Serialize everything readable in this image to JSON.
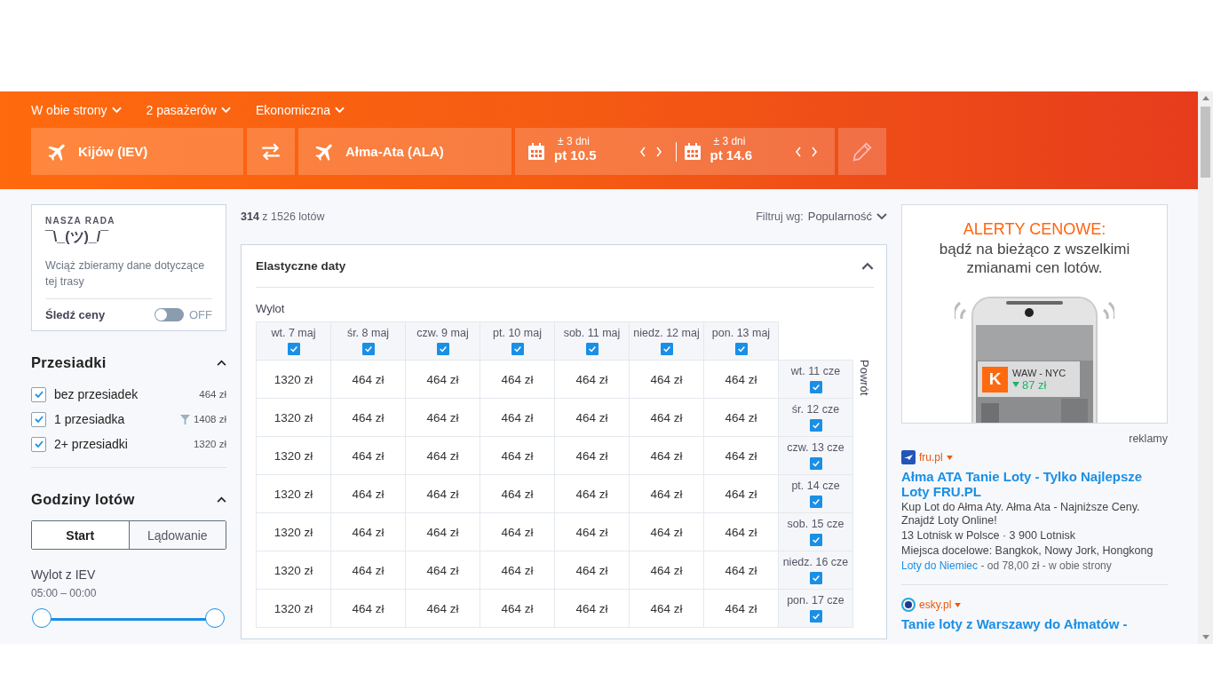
{
  "search_bar": {
    "trip_type": "W obie strony",
    "passengers": "2 pasażerów",
    "cabin": "Ekonomiczna",
    "origin": "Kijów (IEV)",
    "destination": "Ałma-Ata (ALA)",
    "dates": [
      {
        "flex": "± 3 dni",
        "date": "pt 10.5"
      },
      {
        "flex": "± 3 dni",
        "date": "pt 14.6"
      }
    ]
  },
  "advice": {
    "heading": "NASZA RADA",
    "emoticon": "¯\\_(ツ)_/¯",
    "text": "Wciąż zbieramy dane dotyczące tej trasy",
    "track_label": "Śledź ceny",
    "track_on": false,
    "track_state": "OFF"
  },
  "stops": {
    "title": "Przesiadki",
    "items": [
      {
        "label": "bez przesiadek",
        "price": "464 zł",
        "checked": true,
        "filtered": false
      },
      {
        "label": "1 przesiadka",
        "price": "1408 zł",
        "checked": true,
        "filtered": true
      },
      {
        "label": "2+ przesiadki",
        "price": "1320 zł",
        "checked": true,
        "filtered": false
      }
    ]
  },
  "times": {
    "title": "Godziny lotów",
    "tabs": [
      {
        "label": "Start",
        "selected": true
      },
      {
        "label": "Lądowanie",
        "selected": false
      }
    ],
    "label": "Wylot z IEV",
    "range": "05:00 – 00:00",
    "level": 1
  },
  "results": {
    "count": "314",
    "total": "z 1526 lotów",
    "sort_label": "Filtruj wg:",
    "sort_value": "Popularność"
  },
  "flex_dates": {
    "title": "Elastyczne daty",
    "departure_label": "Wylot",
    "return_label": "Powrót",
    "columns": [
      {
        "label": "wt. 7 maj",
        "checked": true
      },
      {
        "label": "śr. 8 maj",
        "checked": true
      },
      {
        "label": "czw. 9 maj",
        "checked": true
      },
      {
        "label": "pt. 10 maj",
        "checked": true
      },
      {
        "label": "sob. 11 maj",
        "checked": true
      },
      {
        "label": "niedz. 12 maj",
        "checked": true
      },
      {
        "label": "pon. 13 maj",
        "checked": true
      }
    ],
    "rows": [
      {
        "label": "wt. 11 cze",
        "checked": true,
        "prices": [
          "1320 zł",
          "464 zł",
          "464 zł",
          "464 zł",
          "464 zł",
          "464 zł",
          "464 zł"
        ]
      },
      {
        "label": "śr. 12 cze",
        "checked": true,
        "prices": [
          "1320 zł",
          "464 zł",
          "464 zł",
          "464 zł",
          "464 zł",
          "464 zł",
          "464 zł"
        ]
      },
      {
        "label": "czw. 13 cze",
        "checked": true,
        "prices": [
          "1320 zł",
          "464 zł",
          "464 zł",
          "464 zł",
          "464 zł",
          "464 zł",
          "464 zł"
        ]
      },
      {
        "label": "pt. 14 cze",
        "checked": true,
        "prices": [
          "1320 zł",
          "464 zł",
          "464 zł",
          "464 zł",
          "464 zł",
          "464 zł",
          "464 zł"
        ]
      },
      {
        "label": "sob. 15 cze",
        "checked": true,
        "prices": [
          "1320 zł",
          "464 zł",
          "464 zł",
          "464 zł",
          "464 zł",
          "464 zł",
          "464 zł"
        ]
      },
      {
        "label": "niedz. 16 cze",
        "checked": true,
        "prices": [
          "1320 zł",
          "464 zł",
          "464 zł",
          "464 zł",
          "464 zł",
          "464 zł",
          "464 zł"
        ]
      },
      {
        "label": "pon. 17 cze",
        "checked": true,
        "prices": [
          "1320 zł",
          "464 zł",
          "464 zł",
          "464 zł",
          "464 zł",
          "464 zł",
          "464 zł"
        ]
      }
    ]
  },
  "banner": {
    "headline": "ALERTY CENOWE:",
    "text": "bądź na bieżąco z wszelkimi zmianami cen lotów.",
    "notification_logo": "K",
    "notification_route": "WAW - NYC",
    "notification_price": "87 zł"
  },
  "ads": {
    "label": "reklamy",
    "items": [
      {
        "kind": "fru",
        "source": "fru.pl",
        "title": "Ałma ATA Tanie Loty - Tylko Najlepsze Loty FRU.PL",
        "lines": [
          "Kup Lot do Ałma Aty. Ałma Ata - Najniższe Ceny. Znajdź Loty Online!",
          "13 Lotnisk w Polsce · 3 900 Lotnisk",
          "Miejsca docelowe: Bangkok, Nowy Jork, Hongkong"
        ],
        "link": "Loty do Niemiec",
        "link_rest": "- od 78,00 zł - w obie strony"
      },
      {
        "kind": "esky",
        "source": "esky.pl",
        "title": "Tanie loty z Warszawy do Ałmatów -"
      }
    ]
  }
}
